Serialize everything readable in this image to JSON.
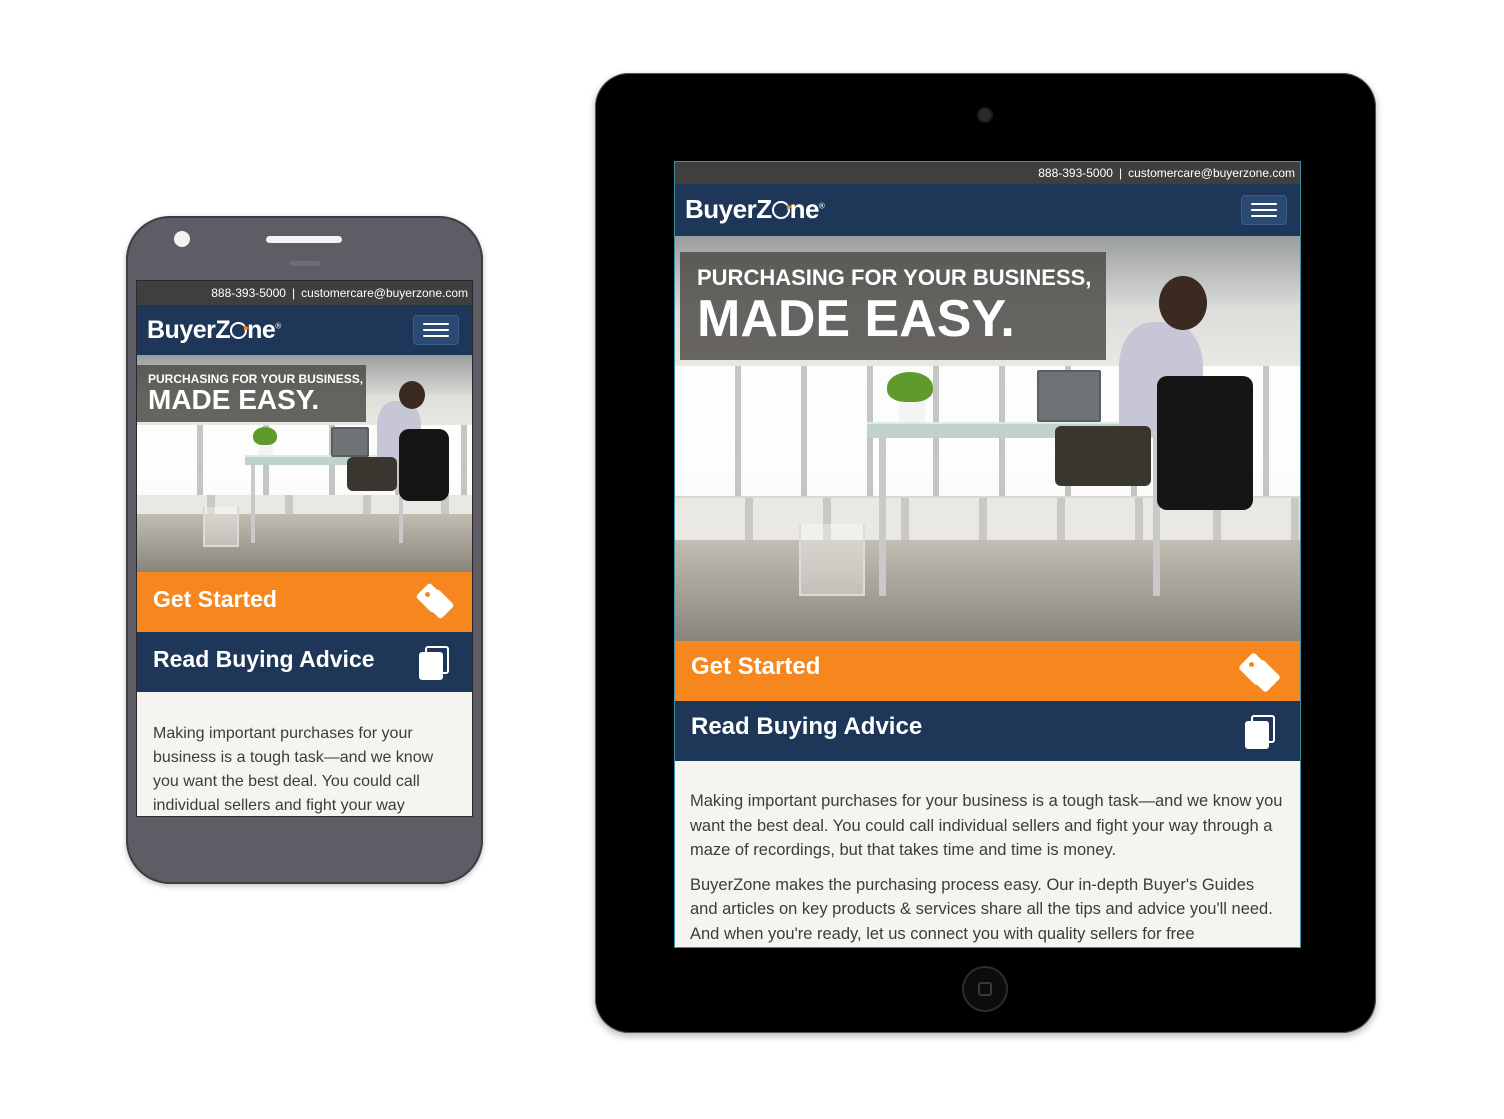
{
  "site": {
    "phone_number": "888-393-5000",
    "separator": "|",
    "email": "customercare@buyerzone.com",
    "logo_text_a": "BuyerZ",
    "logo_text_b": "ne",
    "logo_reg": "®",
    "hero_line1": "PURCHASING FOR YOUR BUSINESS,",
    "hero_line2": "MADE EASY.",
    "cta_primary": "Get Started",
    "cta_secondary": "Read Buying Advice",
    "paragraph_1": "Making important purchases for your business is a tough task—and we know you want the best deal. You could call individual sellers and fight your way through a maze of recordings, but that takes time and time is money.",
    "paragraph_2": "BuyerZone makes the purchasing process easy. Our in-depth Buyer's Guides and articles on key products & services share all the tips and advice you'll need. And when you're ready, let us connect you with quality sellers for free"
  },
  "icons": {
    "menu": "hamburger-menu-icon",
    "tag": "price-tag-icon",
    "book": "book-icon"
  },
  "colors": {
    "navy": "#1e3658",
    "orange": "#f6871f",
    "topbar": "#3f3f3f",
    "body_bg": "#f5f4f1"
  }
}
